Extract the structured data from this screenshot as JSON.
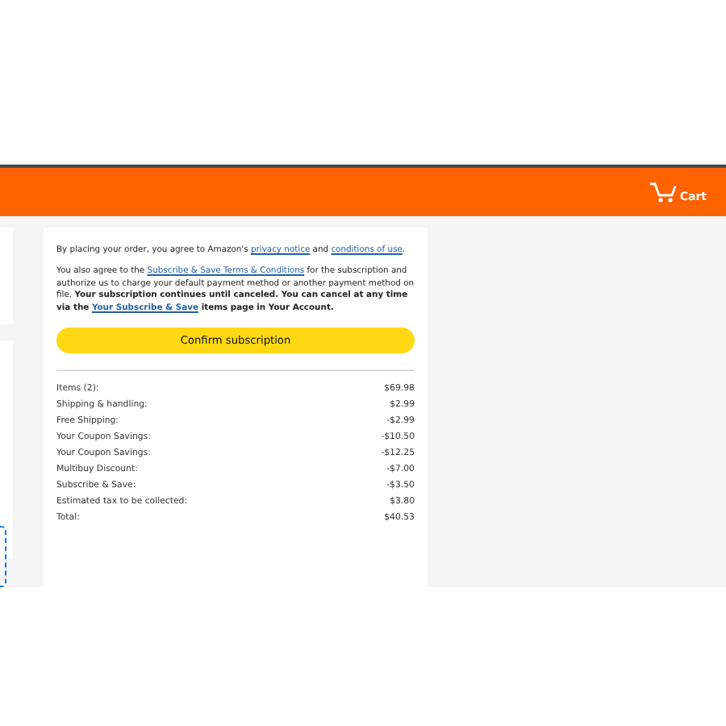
{
  "header": {
    "cart_label": "Cart"
  },
  "agreement": {
    "privacy": [
      {
        "kind": "text",
        "text": "By placing your order, you agree to Amazon's "
      },
      {
        "kind": "link",
        "text": "privacy notice"
      },
      {
        "kind": "text",
        "text": " and "
      },
      {
        "kind": "link",
        "text": "conditions of use"
      },
      {
        "kind": "text",
        "text": "."
      }
    ],
    "subscription": [
      {
        "kind": "text",
        "bold": false,
        "text": "You also agree to the "
      },
      {
        "kind": "link",
        "bold": false,
        "text": "Subscribe & Save Terms & Conditions"
      },
      {
        "kind": "text",
        "bold": false,
        "text": " for the subscription and authorize us to charge your default payment method or another payment method on file. "
      },
      {
        "kind": "text",
        "bold": true,
        "text": "Your subscription continues until canceled. You can cancel at any time via the "
      },
      {
        "kind": "link",
        "bold": true,
        "text": "Your Subscribe & Save"
      },
      {
        "kind": "text",
        "bold": true,
        "text": " items page in Your Account."
      }
    ]
  },
  "confirm_button": "Confirm subscription",
  "summary": [
    {
      "label": "Items (2):",
      "amount": "$69.98"
    },
    {
      "label": "Shipping & handling:",
      "amount": "$2.99"
    },
    {
      "label": "Free Shipping:",
      "amount": "-$2.99"
    },
    {
      "label": "Your Coupon Savings:",
      "amount": "-$10.50"
    },
    {
      "label": "Your Coupon Savings:",
      "amount": "-$12.25"
    },
    {
      "label": "Multibuy Discount:",
      "amount": "-$7.00"
    },
    {
      "label": "Subscribe & Save:",
      "amount": "-$3.50"
    },
    {
      "label": "Estimated tax to be collected:",
      "amount": "$3.80"
    },
    {
      "label": "Total:",
      "amount": "$40.53"
    }
  ]
}
